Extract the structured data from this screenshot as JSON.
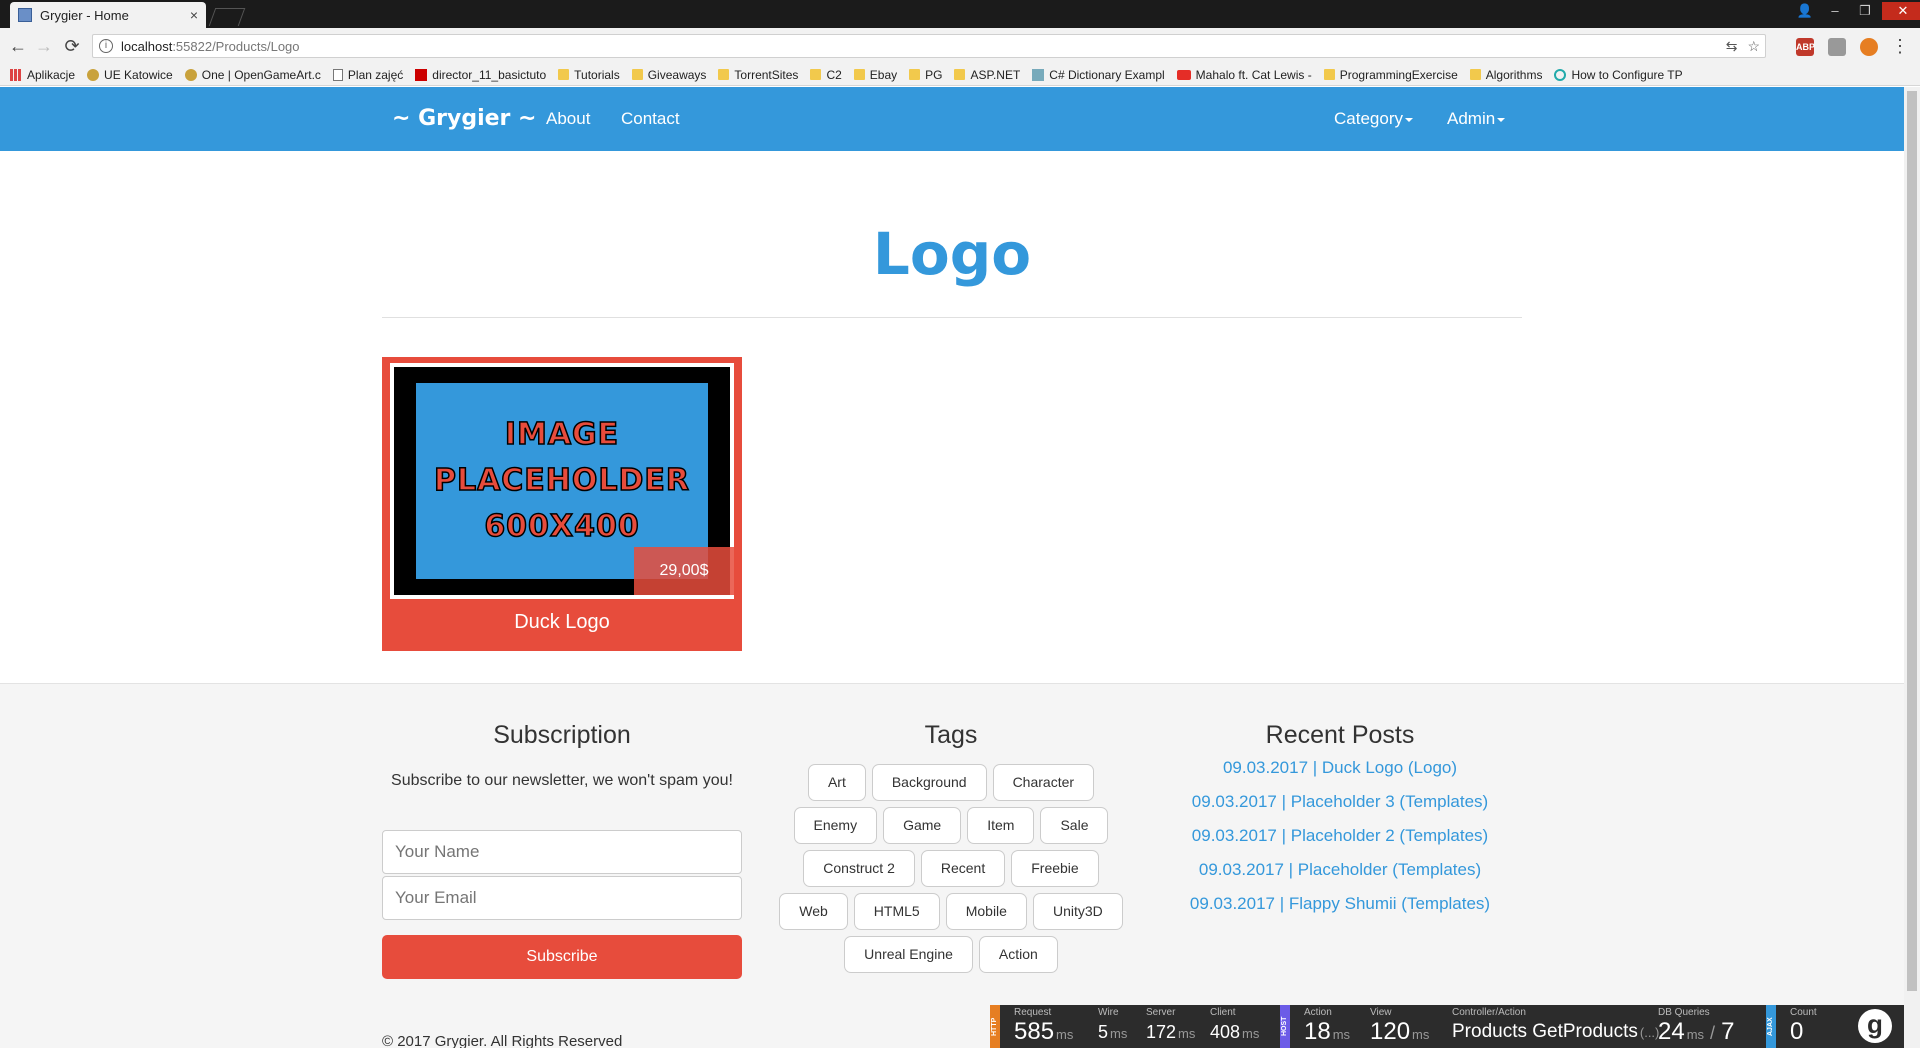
{
  "browser": {
    "tab_title": "Grygier - Home",
    "tab_close": "×",
    "url_host": "localhost",
    "url_path": ":55822/Products/Logo",
    "win_user": "👤",
    "win_min": "–",
    "win_restore": "❐",
    "win_close": "✕",
    "back_glyph": "←",
    "forward_glyph": "→",
    "reload_glyph": "⟳",
    "info_glyph": "i",
    "translate_glyph": "⇆",
    "star_glyph": "☆",
    "menu_glyph": "⋮",
    "ext_abp": "ABP",
    "bookmarks": [
      {
        "label": "Aplikacje",
        "icon": "apps-icon"
      },
      {
        "label": "UE Katowice",
        "icon": "misc-icon"
      },
      {
        "label": "One | OpenGameArt.c",
        "icon": "misc-icon"
      },
      {
        "label": "Plan zajęć",
        "icon": "page-icon"
      },
      {
        "label": "director_11_basictuto",
        "icon": "acrobat-icon"
      },
      {
        "label": "Tutorials",
        "icon": "folder-icon"
      },
      {
        "label": "Giveaways",
        "icon": "folder-icon"
      },
      {
        "label": "TorrentSites",
        "icon": "folder-icon"
      },
      {
        "label": "C2",
        "icon": "folder-icon"
      },
      {
        "label": "Ebay",
        "icon": "folder-icon"
      },
      {
        "label": "PG",
        "icon": "folder-icon"
      },
      {
        "label": "ASP.NET",
        "icon": "folder-icon"
      },
      {
        "label": "C# Dictionary Exampl",
        "icon": "image-icon"
      },
      {
        "label": "Mahalo ft. Cat Lewis -",
        "icon": "youtube-icon"
      },
      {
        "label": "ProgrammingExercise",
        "icon": "folder-icon"
      },
      {
        "label": "Algorithms",
        "icon": "folder-icon"
      },
      {
        "label": "How to Configure TP",
        "icon": "tp-icon"
      }
    ]
  },
  "navbar": {
    "brand": "~ Grygier ~",
    "about": "About",
    "contact": "Contact",
    "category": "Category",
    "admin": "Admin"
  },
  "page": {
    "title": "Logo"
  },
  "product": {
    "image_text": [
      "IMAGE",
      "PLACEHOLDER",
      "600X400"
    ],
    "price": "29,00$",
    "name": "Duck Logo"
  },
  "footer": {
    "subscription": {
      "title": "Subscription",
      "text": "Subscribe to our newsletter, we won't spam you!",
      "name_placeholder": "Your Name",
      "email_placeholder": "Your Email",
      "button": "Subscribe"
    },
    "tags": {
      "title": "Tags",
      "items": [
        "Art",
        "Background",
        "Character",
        "Enemy",
        "Game",
        "Item",
        "Sale",
        "Construct 2",
        "Recent",
        "Freebie",
        "Web",
        "HTML5",
        "Mobile",
        "Unity3D",
        "Unreal Engine",
        "Action"
      ]
    },
    "recent_posts": {
      "title": "Recent Posts",
      "items": [
        "09.03.2017 | Duck Logo (Logo)",
        "09.03.2017 | Placeholder 3 (Templates)",
        "09.03.2017 | Placeholder 2 (Templates)",
        "09.03.2017 | Placeholder (Templates)",
        "09.03.2017 | Flappy Shumii (Templates)"
      ]
    },
    "copyright": "© 2017 Grygier. All Rights Reserved"
  },
  "glimpse": {
    "http_tag": "HTTP",
    "host_tag": "HOST",
    "ajax_tag": "AJAX",
    "request": {
      "label": "Request",
      "value": "585",
      "unit": "ms"
    },
    "wire": {
      "label": "Wire",
      "value": "5",
      "unit": "ms"
    },
    "server": {
      "label": "Server",
      "value": "172",
      "unit": "ms"
    },
    "client": {
      "label": "Client",
      "value": "408",
      "unit": "ms"
    },
    "action": {
      "label": "Action",
      "value": "18",
      "unit": "ms"
    },
    "view": {
      "label": "View",
      "value": "120",
      "unit": "ms"
    },
    "controller_action": {
      "label": "Controller/Action",
      "value": "Products GetProducts",
      "unit": "(...)"
    },
    "db_queries": {
      "label": "DB Queries",
      "value": "24",
      "unit": "ms",
      "count": "7",
      "sep": "/"
    },
    "count": {
      "label": "Count",
      "value": "0"
    },
    "logo": "g"
  },
  "colors": {
    "primary": "#3498db",
    "accent": "#e74c3c"
  }
}
